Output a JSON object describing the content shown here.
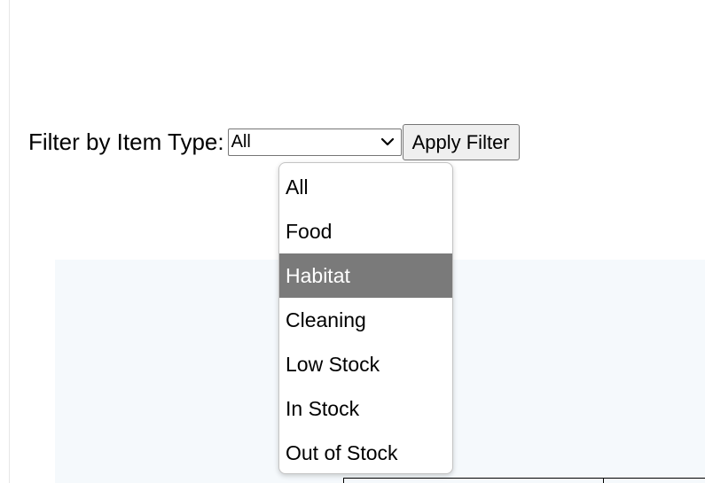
{
  "filter": {
    "label": "Filter by Item Type:",
    "selected_value": "All",
    "apply_label": "Apply Filter",
    "highlighted_option": "Habitat",
    "options": [
      "All",
      "Food",
      "Habitat",
      "Cleaning",
      "Low Stock",
      "In Stock",
      "Out of Stock"
    ]
  },
  "icons": {
    "select_arrow": "chevron-down-icon"
  },
  "colors": {
    "highlight_bg": "#7a7a7a",
    "highlight_text": "#ffffff",
    "panel_bg": "#f5f9fc",
    "button_bg": "#efefef"
  }
}
